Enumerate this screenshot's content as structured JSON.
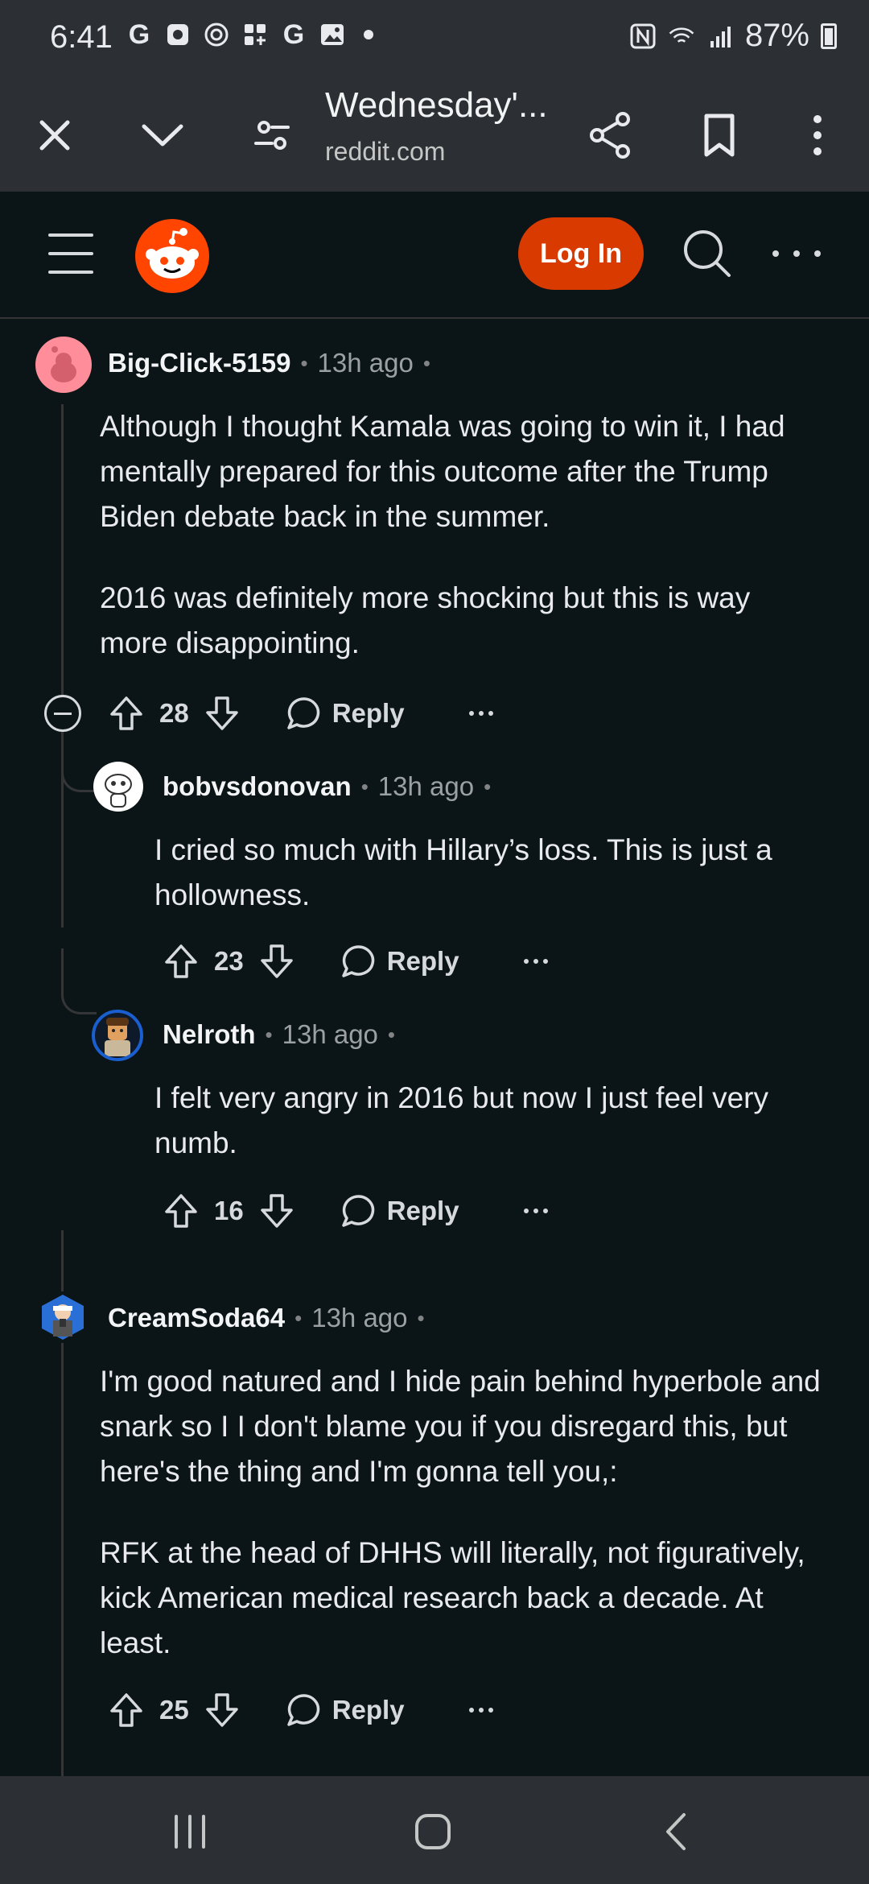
{
  "status_bar": {
    "time": "6:41",
    "icons_left": [
      "google-icon",
      "calendar-icon",
      "vpn-icon",
      "apps-icon",
      "google-icon",
      "gallery-icon"
    ],
    "battery": "87%"
  },
  "browser": {
    "title": "Wednesday'...",
    "url": "reddit.com"
  },
  "header": {
    "login_label": "Log In"
  },
  "comments": [
    {
      "author": "Big-Click-5159",
      "time": "13h ago",
      "paragraphs": [
        "Although I thought Kamala was going to win it, I had mentally prepared for this outcome after the Trump Biden debate back in the summer.",
        "2016 was definitely more shocking but this is way more disappointing."
      ],
      "votes": "28",
      "reply_label": "Reply"
    },
    {
      "author": "bobvsdonovan",
      "time": "13h ago",
      "paragraphs": [
        "I cried so much with Hillary’s loss. This is just a hollowness."
      ],
      "votes": "23",
      "reply_label": "Reply"
    },
    {
      "author": "Nelroth",
      "time": "13h ago",
      "paragraphs": [
        "I felt very angry in 2016 but now I just feel very numb."
      ],
      "votes": "16",
      "reply_label": "Reply"
    },
    {
      "author": "CreamSoda64",
      "time": "13h ago",
      "paragraphs": [
        "I'm good natured and I hide pain behind hyperbole and snark so I I don't blame you if you disregard this, but here's the thing and I'm gonna tell you,:",
        "RFK at the head of DHHS will literally, not figuratively, kick American medical research back a decade. At least."
      ],
      "votes": "25",
      "reply_label": "Reply"
    }
  ],
  "colors": {
    "background": "#0b1416",
    "chrome": "#2c2f33",
    "reddit_orange": "#ff4500",
    "login_button": "#d93a00"
  }
}
